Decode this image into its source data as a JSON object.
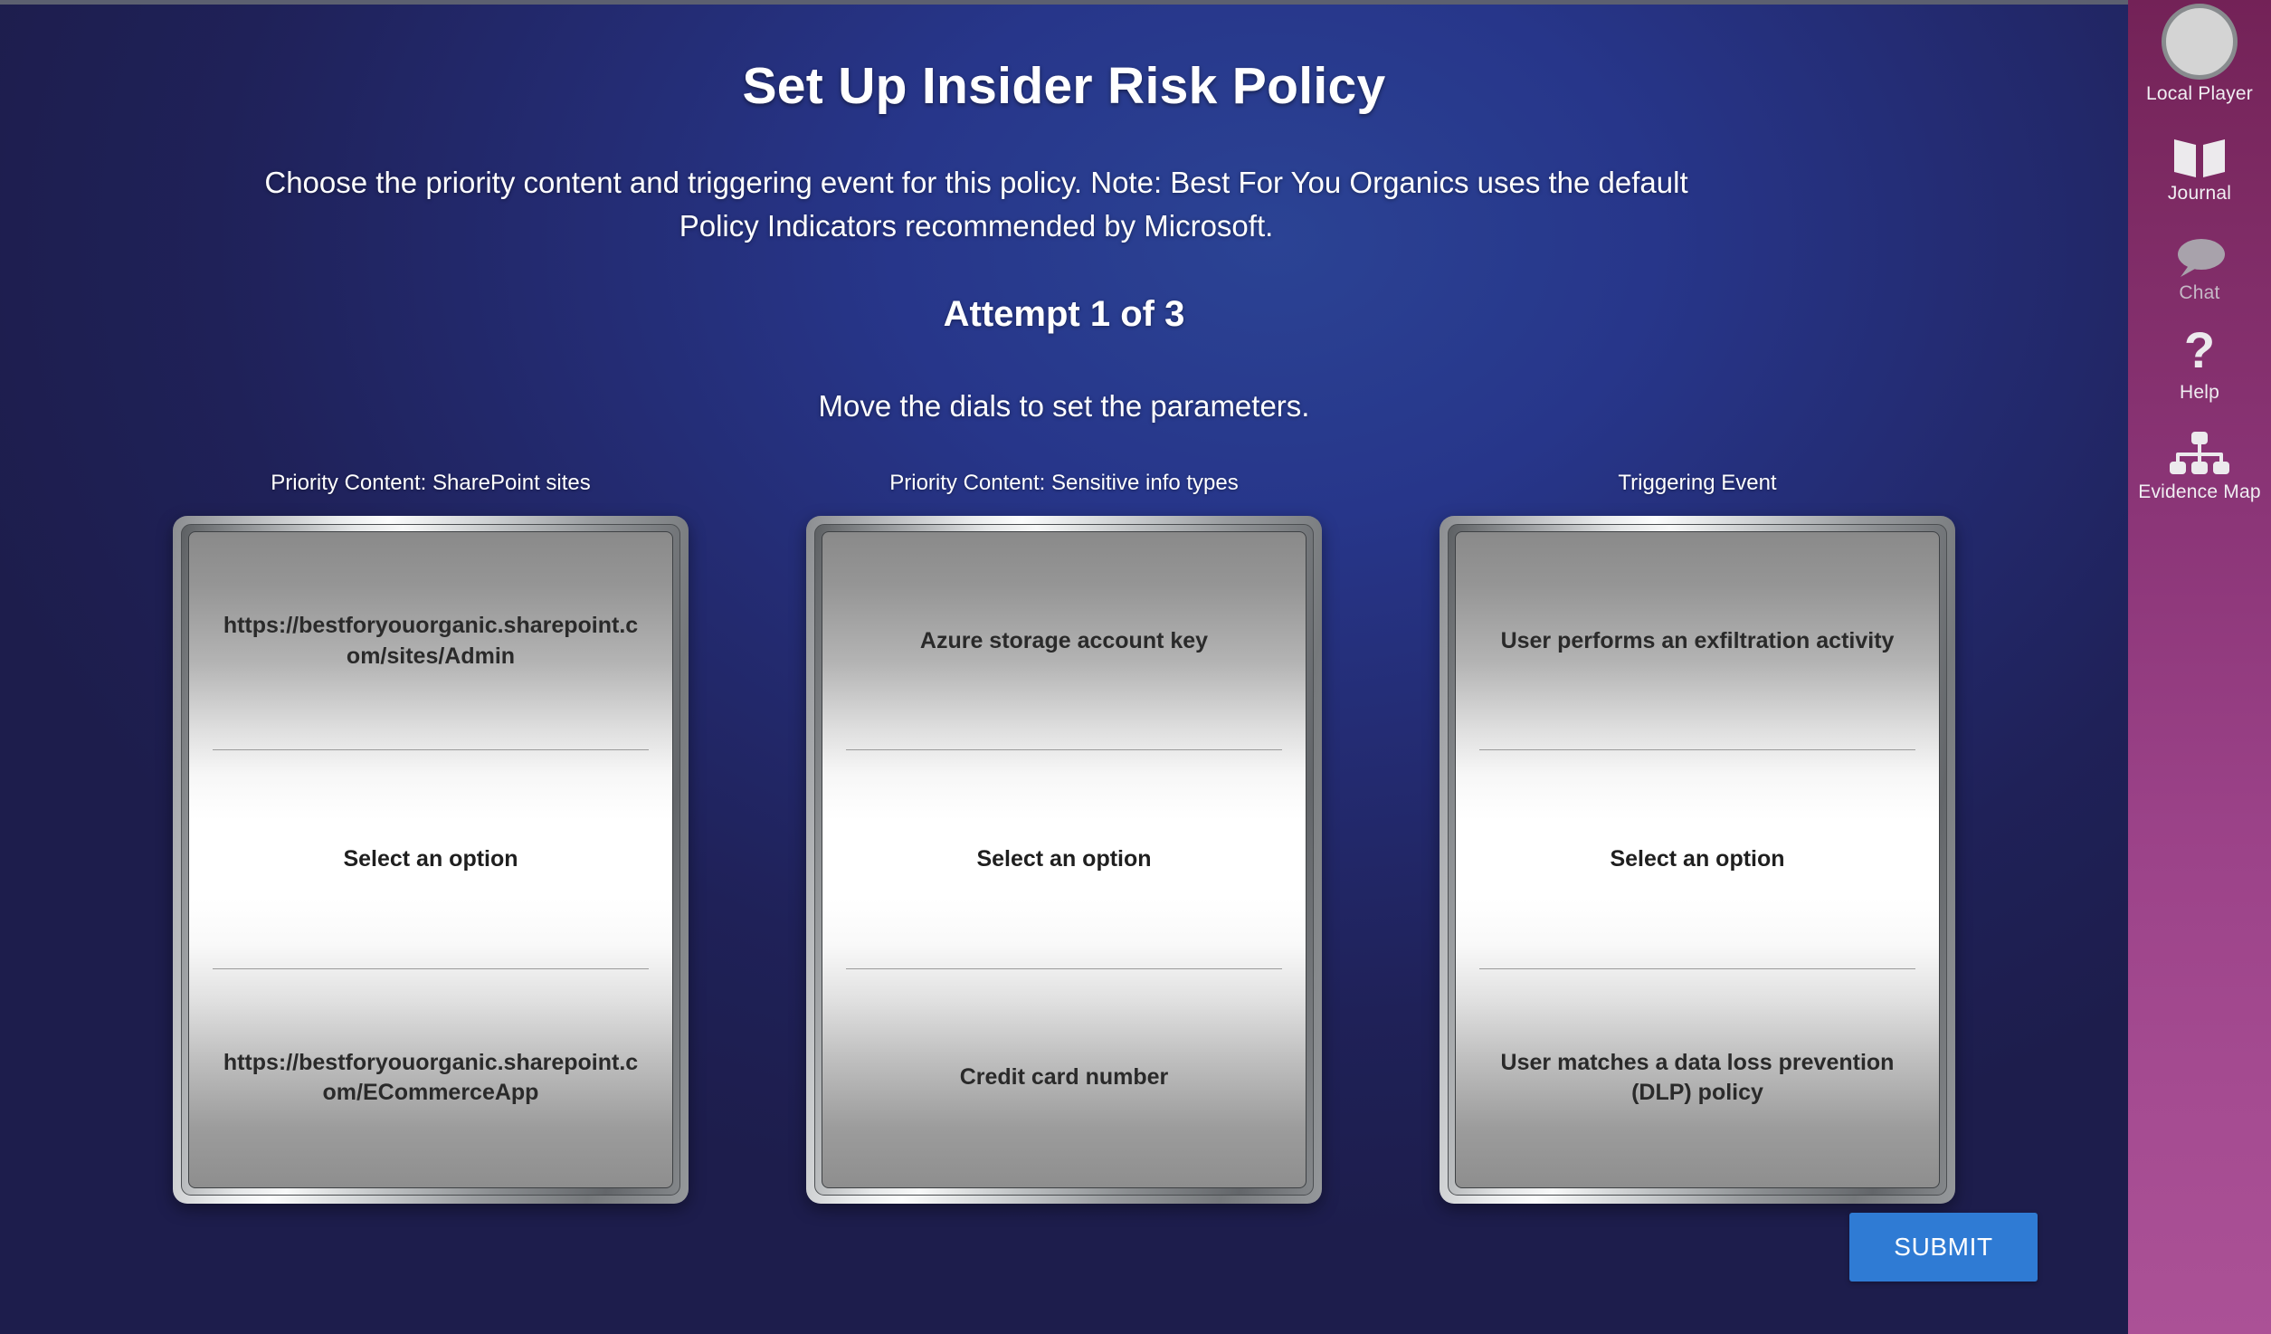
{
  "header": {
    "title": "Set Up Insider Risk Policy",
    "description": "Choose the priority content and triggering event for this policy. Note: Best For You Organics uses the default Policy Indicators recommended by Microsoft.",
    "attempt": "Attempt 1 of 3",
    "hint": "Move the dials to set the parameters."
  },
  "dials": [
    {
      "caption": "Priority Content: SharePoint sites",
      "slots": [
        "https://bestforyouorganic.sharepoint.com/sites/Admin",
        "Select an option",
        "https://bestforyouorganic.sharepoint.com/ECommerceApp"
      ]
    },
    {
      "caption": "Priority Content: Sensitive info types",
      "slots": [
        "Azure storage account key",
        "Select an option",
        "Credit card number"
      ]
    },
    {
      "caption": "Triggering Event",
      "slots": [
        "User performs an exfiltration activity",
        "Select an option",
        "User matches a data loss prevention (DLP) policy"
      ]
    }
  ],
  "actions": {
    "submit_label": "SUBMIT"
  },
  "sidebar": {
    "items": [
      {
        "label": "Local Player",
        "icon": "avatar-icon"
      },
      {
        "label": "Journal",
        "icon": "book-icon"
      },
      {
        "label": "Chat",
        "icon": "chat-bubble-icon"
      },
      {
        "label": "Help",
        "icon": "question-mark-icon"
      },
      {
        "label": "Evidence Map",
        "icon": "hierarchy-map-icon"
      }
    ]
  },
  "colors": {
    "background_top": "#2b4394",
    "background_bottom": "#1d1d4c",
    "sidebar_top": "#732257",
    "sidebar_bottom": "#ab5196",
    "submit_blue": "#2f7bd4",
    "dial_text": "#2a2a2a"
  }
}
